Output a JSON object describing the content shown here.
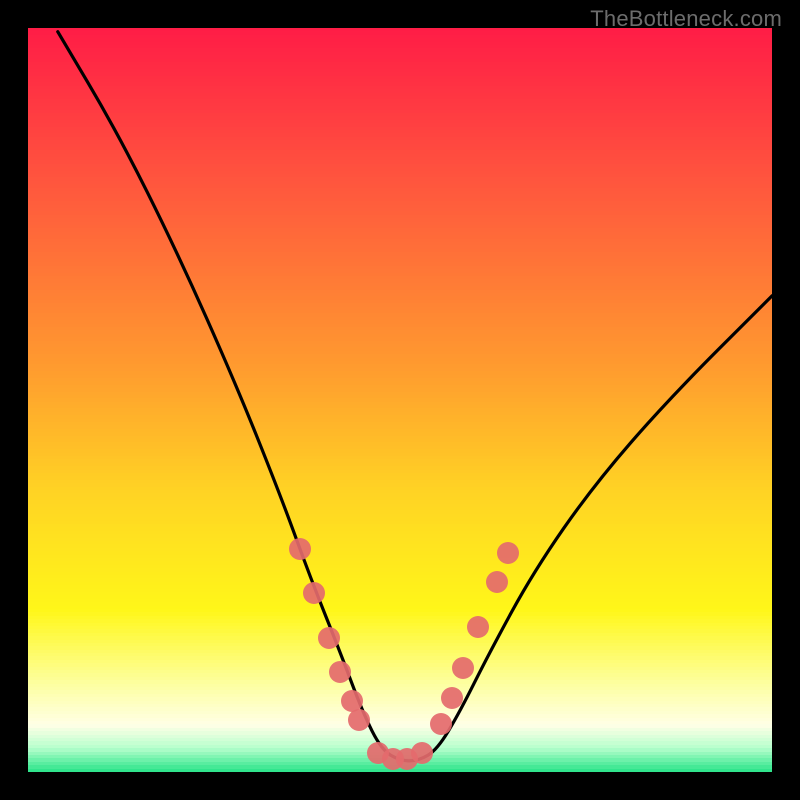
{
  "watermark": "TheBottleneck.com",
  "colors": {
    "frame": "#000000",
    "watermark": "#6c6c6c",
    "curve": "#000000",
    "marker": "#e46a6d",
    "bottom_band": "#1de183"
  },
  "gradient_stops": [
    {
      "pos": 0.0,
      "color": "#ff1d46"
    },
    {
      "pos": 0.22,
      "color": "#ff5a3d"
    },
    {
      "pos": 0.45,
      "color": "#ff9a2f"
    },
    {
      "pos": 0.62,
      "color": "#ffd324"
    },
    {
      "pos": 0.78,
      "color": "#fff719"
    },
    {
      "pos": 0.88,
      "color": "#fdffa1"
    },
    {
      "pos": 0.935,
      "color": "#ffffe6"
    },
    {
      "pos": 0.965,
      "color": "#b7ffcd"
    },
    {
      "pos": 1.0,
      "color": "#1de183"
    }
  ],
  "chart_data": {
    "type": "line",
    "title": "",
    "xlabel": "",
    "ylabel": "",
    "xlim": [
      0,
      100
    ],
    "ylim": [
      0,
      100
    ],
    "series": [
      {
        "name": "bottleneck-curve",
        "x": [
          4.0,
          12.0,
          20.0,
          28.0,
          34.0,
          38.0,
          42.0,
          45.0,
          47.5,
          50.0,
          52.5,
          55.0,
          58.0,
          62.0,
          68.0,
          76.0,
          86.0,
          100.0
        ],
        "y": [
          99.5,
          86.0,
          70.0,
          52.0,
          37.0,
          26.0,
          16.0,
          8.0,
          3.0,
          1.5,
          1.5,
          3.0,
          8.0,
          16.0,
          27.0,
          38.5,
          50.0,
          64.0
        ]
      }
    ],
    "markers_left": [
      {
        "x": 36.5,
        "y": 30.0
      },
      {
        "x": 38.5,
        "y": 24.0
      },
      {
        "x": 40.5,
        "y": 18.0
      },
      {
        "x": 42.0,
        "y": 13.5
      },
      {
        "x": 43.5,
        "y": 9.5
      },
      {
        "x": 44.5,
        "y": 7.0
      }
    ],
    "markers_bottom": [
      {
        "x": 47.0,
        "y": 2.5
      },
      {
        "x": 49.0,
        "y": 1.7
      },
      {
        "x": 51.0,
        "y": 1.7
      },
      {
        "x": 53.0,
        "y": 2.5
      }
    ],
    "markers_right": [
      {
        "x": 55.5,
        "y": 6.5
      },
      {
        "x": 57.0,
        "y": 10.0
      },
      {
        "x": 58.5,
        "y": 14.0
      },
      {
        "x": 60.5,
        "y": 19.5
      },
      {
        "x": 63.0,
        "y": 25.5
      },
      {
        "x": 64.5,
        "y": 29.5
      }
    ]
  }
}
